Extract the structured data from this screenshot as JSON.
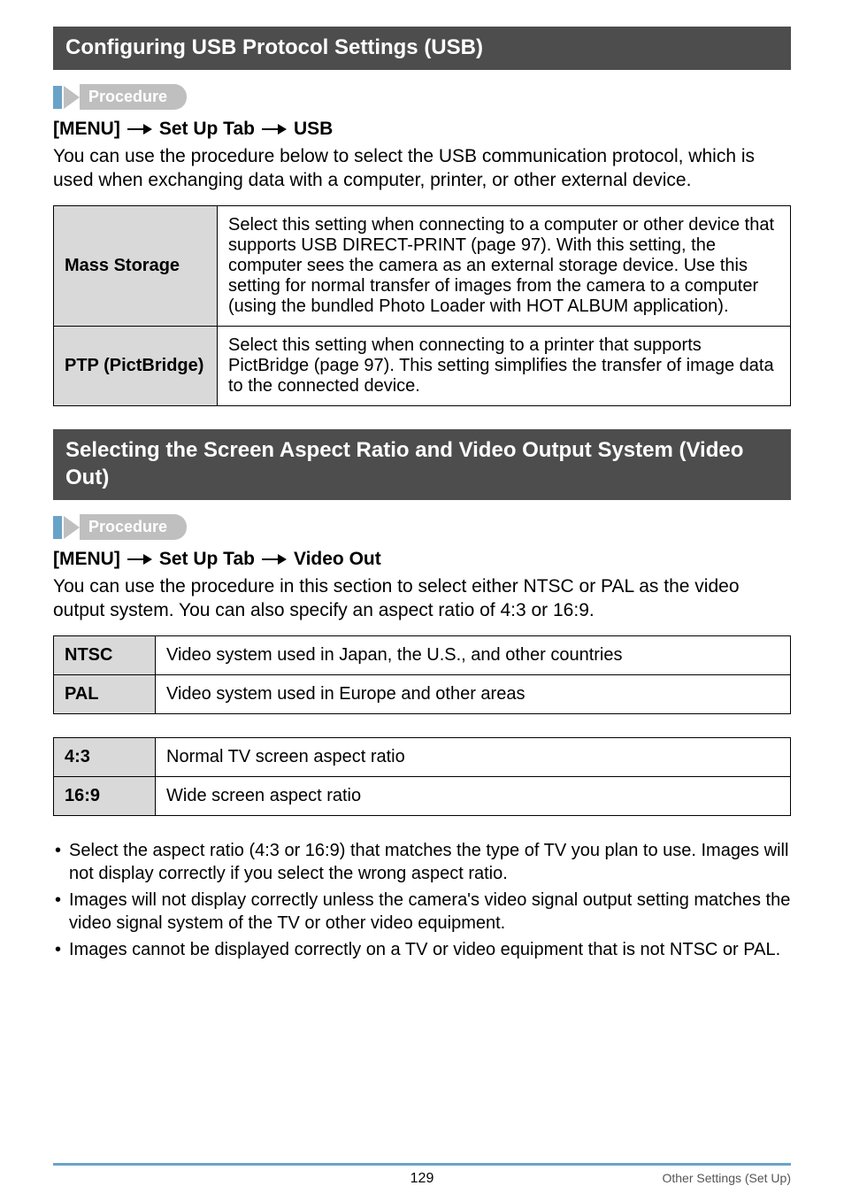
{
  "section1": {
    "title": "Configuring USB Protocol Settings (USB)",
    "procedure_label": "Procedure",
    "menu_parts": [
      "[MENU]",
      "Set Up Tab",
      "USB"
    ],
    "intro": "You can use the procedure below to select the USB communication protocol, which is used when exchanging data with a computer, printer, or other external device.",
    "rows": [
      {
        "label": "Mass Storage",
        "text": "Select this setting when connecting to a computer or other device that supports USB DIRECT-PRINT (page 97). With this setting, the computer sees the camera as an external storage device. Use this setting for normal transfer of images from the camera to a computer (using the bundled Photo Loader with HOT ALBUM application)."
      },
      {
        "label": "PTP (PictBridge)",
        "text": "Select this setting when connecting to a printer that supports PictBridge (page 97). This setting simplifies the transfer of image data to the connected device."
      }
    ]
  },
  "section2": {
    "title": "Selecting the Screen Aspect Ratio and Video Output System (Video Out)",
    "procedure_label": "Procedure",
    "menu_parts": [
      "[MENU]",
      "Set Up Tab",
      "Video Out"
    ],
    "intro": "You can use the procedure in this section to select either NTSC or PAL as the video output system. You can also specify an aspect ratio of 4:3 or 16:9.",
    "video_rows": [
      {
        "label": "NTSC",
        "text": "Video system used in Japan, the U.S., and other countries"
      },
      {
        "label": "PAL",
        "text": "Video system used in Europe and other areas"
      }
    ],
    "aspect_rows": [
      {
        "label": "4:3",
        "text": "Normal TV screen aspect ratio"
      },
      {
        "label": "16:9",
        "text": "Wide screen aspect ratio"
      }
    ],
    "bullets": [
      "Select the aspect ratio (4:3 or 16:9) that matches the type of TV you plan to use. Images will not display correctly if you select the wrong aspect ratio.",
      "Images will not display correctly unless the camera's video signal output setting matches the video signal system of the TV or other video equipment.",
      "Images cannot be displayed correctly on a TV or video equipment that is not NTSC or PAL."
    ]
  },
  "footer": {
    "page": "129",
    "right": "Other Settings (Set Up)"
  }
}
